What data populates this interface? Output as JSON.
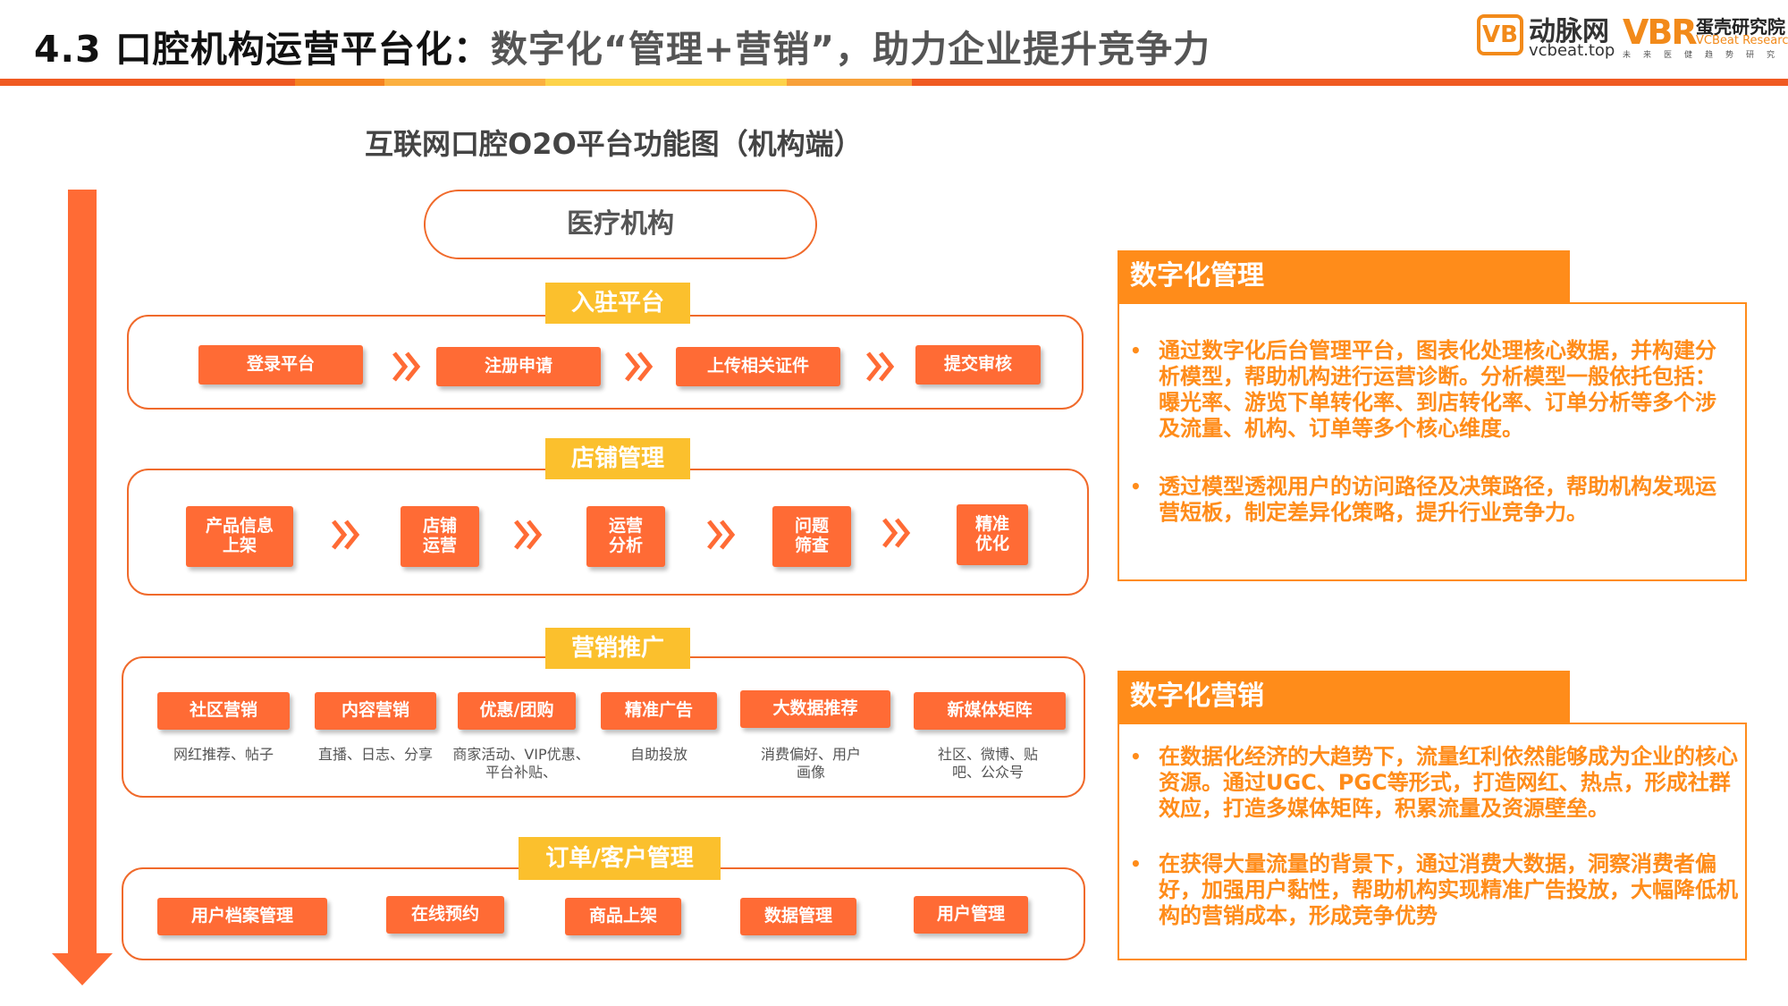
{
  "header": {
    "title_prefix": "4.3 口腔机构运营平台化：",
    "title_suffix": "数字化“管理+营销”，助力企业提升竞争力",
    "bar_colors": [
      "#f05a22",
      "#f58220",
      "#fbb040",
      "#fdd34a",
      "#f8a13a",
      "#f05a22"
    ]
  },
  "logos": {
    "vb_mark": "VB",
    "vb_name": "动脉网",
    "vb_url": "vcbeat.top",
    "vbr_mark": "VBR",
    "vbr_name": "蛋壳研究院",
    "vbr_en": "VCBeat Research",
    "vbr_sub": "未来医健趋势研究"
  },
  "diagram": {
    "title": "互联网口腔O2O平台功能图（机构端）",
    "org": "医疗机构",
    "sections": [
      {
        "label": "入驻平台",
        "items": [
          "登录平台",
          "注册申请",
          "上传相关证件",
          "提交审核"
        ]
      },
      {
        "label": "店铺管理",
        "items": [
          "产品信息\n上架",
          "店铺\n运营",
          "运营\n分析",
          "问题\n筛查",
          "精准\n优化"
        ]
      },
      {
        "label": "营销推广",
        "items": [
          "社区营销",
          "内容营销",
          "优惠/团购",
          "精准广告",
          "大数据推荐",
          "新媒体矩阵"
        ],
        "captions": [
          "网红推荐、帖子",
          "直播、日志、分享",
          "商家活动、VIP优惠、\n平台补贴、",
          "自助投放",
          "消费偏好、用户\n画像",
          "社区、微博、贴\n吧、公众号"
        ]
      },
      {
        "label": "订单/客户管理",
        "items": [
          "用户档案管理",
          "在线预约",
          "商品上架",
          "数据管理",
          "用户管理"
        ]
      }
    ]
  },
  "panels": [
    {
      "title": "数字化管理",
      "bullets": [
        "通过数字化后台管理平台，图表化处理核心数据，并构建分析模型，帮助机构进行运营诊断。分析模型一般依托包括：曝光率、游览下单转化率、到店转化率、订单分析等多个涉及流量、机构、订单等多个核心维度。",
        "透过模型透视用户的访问路径及决策路径，帮助机构发现运营短板，制定差异化策略，提升行业竞争力。"
      ]
    },
    {
      "title": "数字化营销",
      "bullets": [
        "在数据化经济的大趋势下，流量红利依然能够成为企业的核心资源。通过UGC、PGC等形式，打造网红、热点，形成社群效应，打造多媒体矩阵，积累流量及资源壁垒。",
        "在获得大量流量的背景下，通过消费大数据，洞察消费者偏好，加强用户黏性，帮助机构实现精准广告投放，大幅降低机构的营销成本，形成竞争优势"
      ]
    }
  ],
  "colors": {
    "accent": "#ff6b35",
    "label_yellow": "#fbc02d",
    "panel_orange": "#ff8c1a"
  },
  "icons": {
    "flow_arrow": "double-chevron-right-icon",
    "timeline": "down-arrow-icon"
  }
}
